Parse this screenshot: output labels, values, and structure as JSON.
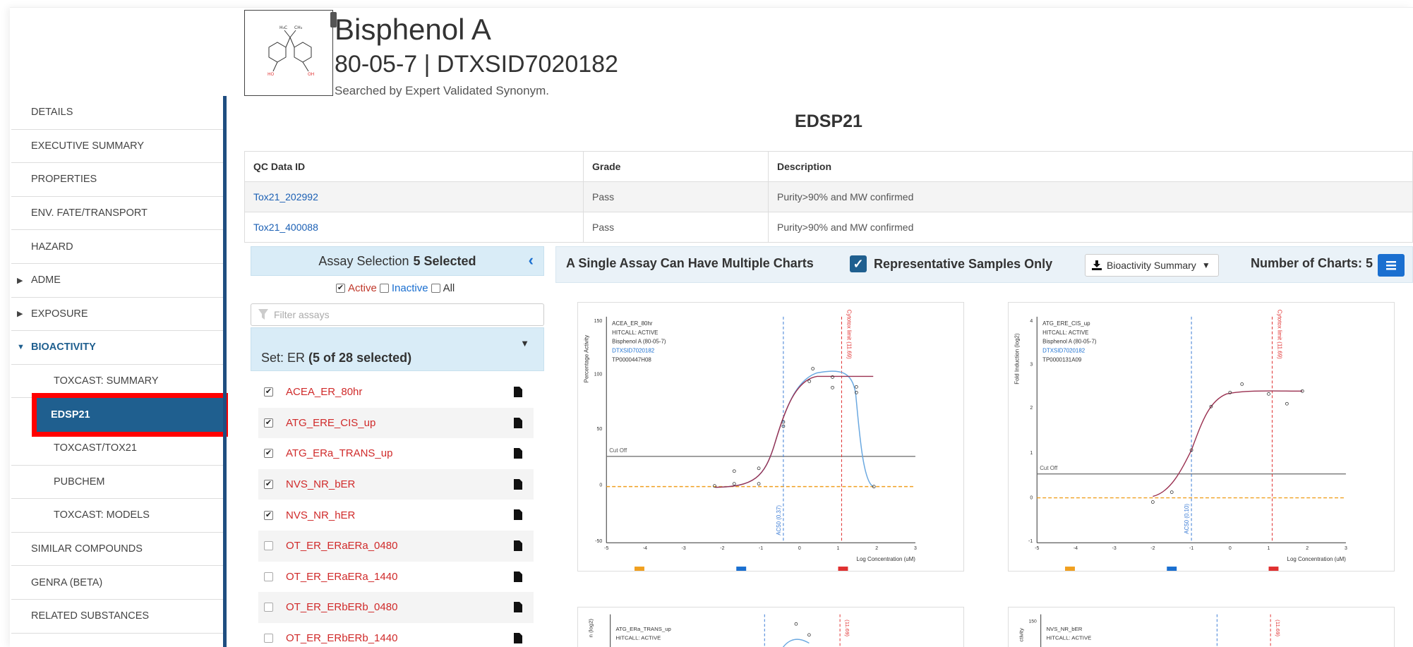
{
  "compound": {
    "name": "Bisphenol A",
    "ids": "80-05-7 | DTXSID7020182",
    "searched_by": "Searched by Expert Validated Synonym."
  },
  "sidebar": {
    "items": [
      {
        "label": "DETAILS"
      },
      {
        "label": "EXECUTIVE SUMMARY"
      },
      {
        "label": "PROPERTIES"
      },
      {
        "label": "ENV. FATE/TRANSPORT"
      },
      {
        "label": "HAZARD"
      },
      {
        "label": "ADME"
      },
      {
        "label": "EXPOSURE"
      },
      {
        "label": "BIOACTIVITY"
      },
      {
        "label": "TOXCAST: SUMMARY"
      },
      {
        "label": "EDSP21"
      },
      {
        "label": "TOXCAST/TOX21"
      },
      {
        "label": "PUBCHEM"
      },
      {
        "label": "TOXCAST: MODELS"
      },
      {
        "label": "SIMILAR COMPOUNDS"
      },
      {
        "label": "GENRA (BETA)"
      },
      {
        "label": "RELATED SUBSTANCES"
      }
    ]
  },
  "section_title": "EDSP21",
  "qc_table": {
    "headers": [
      "QC Data ID",
      "Grade",
      "Description"
    ],
    "rows": [
      [
        "Tox21_202992",
        "Pass",
        "Purity>90% and MW confirmed"
      ],
      [
        "Tox21_400088",
        "Pass",
        "Purity>90% and MW confirmed"
      ]
    ]
  },
  "assay_panel": {
    "title": "Assay Selection",
    "selected": "5 Selected",
    "filter_active": "Active",
    "filter_inactive": "Inactive",
    "filter_all": "All",
    "filter_placeholder": "Filter assays",
    "set_label": "Set: ER",
    "set_count": "(5 of 28 selected)",
    "assays": [
      {
        "name": "ACEA_ER_80hr",
        "checked": true
      },
      {
        "name": "ATG_ERE_CIS_up",
        "checked": true
      },
      {
        "name": "ATG_ERa_TRANS_up",
        "checked": true
      },
      {
        "name": "NVS_NR_bER",
        "checked": true
      },
      {
        "name": "NVS_NR_hER",
        "checked": true
      },
      {
        "name": "OT_ER_ERaERa_0480",
        "checked": false
      },
      {
        "name": "OT_ER_ERaERa_1440",
        "checked": false
      },
      {
        "name": "OT_ER_ERbERb_0480",
        "checked": false
      },
      {
        "name": "OT_ER_ERbERb_1440",
        "checked": false
      }
    ]
  },
  "charts_bar": {
    "heading": "A Single Assay Can Have Multiple Charts",
    "representative": "Representative Samples Only",
    "download": "Bioactivity Summary",
    "count_label": "Number of Charts: 5"
  },
  "charts": [
    {
      "assay": "ACEA_ER_80hr",
      "hitcall": "HITCALL: ACTIVE",
      "chemical": "Bisphenol A (80-05-7)",
      "dtxsid": "DTXSID7020182",
      "sample": "TP0000447H08",
      "ylabel": "Percentage Activity",
      "xlabel": "Log Concentration (uM)",
      "cutoff_label": "Cut Off",
      "ac50_label": "AC50 (0.37)",
      "cytotox_label": "Cytotox limit (11.69)",
      "yticks": [
        "150",
        "100",
        "50",
        "0",
        "-50"
      ],
      "xticks": [
        "-5",
        "-4",
        "-3",
        "-2",
        "-1",
        "0",
        "1",
        "2",
        "3"
      ]
    },
    {
      "assay": "ATG_ERE_CIS_up",
      "hitcall": "HITCALL: ACTIVE",
      "chemical": "Bisphenol A (80-05-7)",
      "dtxsid": "DTXSID7020182",
      "sample": "TP0000131A09",
      "ylabel": "Fold Induction (log2)",
      "xlabel": "Log Concentration (uM)",
      "cutoff_label": "Cut Off",
      "ac50_label": "AC50 (0.10)",
      "cytotox_label": "Cytotox limit (11.69)",
      "yticks": [
        "4",
        "3",
        "2",
        "1",
        "0",
        "-1"
      ],
      "xticks": [
        "-5",
        "-4",
        "-3",
        "-2",
        "-1",
        "0",
        "1",
        "2",
        "3"
      ]
    },
    {
      "assay": "ATG_ERa_TRANS_up",
      "hitcall": "HITCALL: ACTIVE",
      "ylabel": "n (log2)",
      "cytotox_label": "(11.69)"
    },
    {
      "assay": "NVS_NR_bER",
      "hitcall": "HITCALL: ACTIVE",
      "ylabel": "ctivity",
      "ytick_top": "150",
      "cytotox_label": "(11.69)"
    }
  ]
}
